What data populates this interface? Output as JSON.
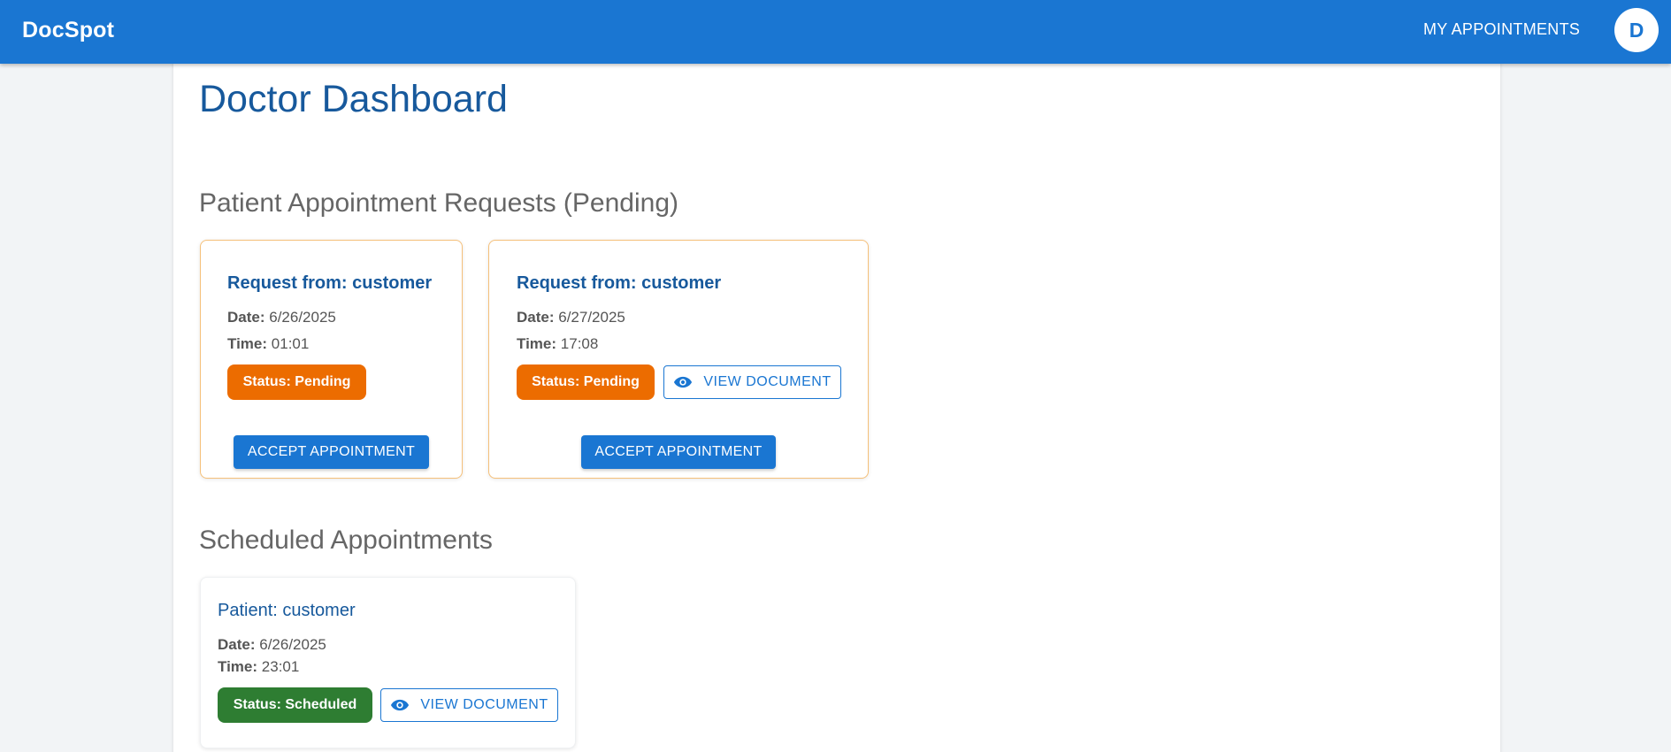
{
  "app": {
    "brand": "DocSpot"
  },
  "nav": {
    "my_appointments": "MY APPOINTMENTS",
    "avatar_initial": "D"
  },
  "page": {
    "title": "Doctor Dashboard"
  },
  "pending": {
    "section_title": "Patient Appointment Requests (Pending)",
    "cards": [
      {
        "title": "Request from: customer",
        "date_label": "Date:",
        "date": "6/26/2025",
        "time_label": "Time:",
        "time": "01:01",
        "status": "Status: Pending",
        "accept": "ACCEPT APPOINTMENT"
      },
      {
        "title": "Request from: customer",
        "date_label": "Date:",
        "date": "6/27/2025",
        "time_label": "Time:",
        "time": "17:08",
        "status": "Status: Pending",
        "view": "VIEW DOCUMENT",
        "accept": "ACCEPT APPOINTMENT"
      }
    ]
  },
  "scheduled": {
    "section_title": "Scheduled Appointments",
    "cards": [
      {
        "title": "Patient: customer",
        "date_label": "Date:",
        "date": "6/26/2025",
        "time_label": "Time:",
        "time": "23:01",
        "status": "Status: Scheduled",
        "view": "VIEW DOCUMENT"
      }
    ]
  },
  "colors": {
    "appbar": "#1a76d2",
    "pending": "#ec6c00",
    "scheduled": "#2e7d32",
    "title": "#17599c"
  }
}
